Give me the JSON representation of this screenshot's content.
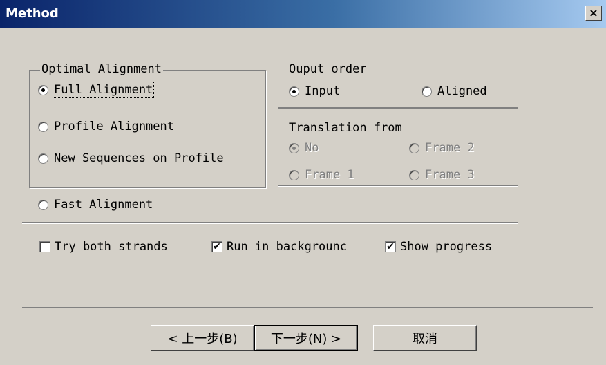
{
  "window": {
    "title": "Method",
    "close_glyph": "×"
  },
  "optimal_alignment": {
    "legend": "Optimal Alignment",
    "options": [
      {
        "label": "Full Alignment",
        "checked": true
      },
      {
        "label": "Profile Alignment",
        "checked": false
      },
      {
        "label": "New Sequences on Profile",
        "checked": false
      }
    ]
  },
  "fast_alignment": {
    "label": "Fast Alignment",
    "checked": false
  },
  "output_order": {
    "heading": "Ouput order",
    "options": [
      {
        "label": "Input",
        "checked": true
      },
      {
        "label": "Aligned",
        "checked": false
      }
    ]
  },
  "translation": {
    "heading": "Translation from",
    "options": [
      {
        "label": "No",
        "checked": true,
        "disabled": true
      },
      {
        "label": "Frame 2",
        "checked": false,
        "disabled": true
      },
      {
        "label": "Frame 1",
        "checked": false,
        "disabled": true
      },
      {
        "label": "Frame 3",
        "checked": false,
        "disabled": true
      }
    ]
  },
  "checkboxes": [
    {
      "label": "Try both strands",
      "checked": false
    },
    {
      "label": "Run in backgrounc",
      "checked": true
    },
    {
      "label": "Show progress",
      "checked": true
    }
  ],
  "buttons": {
    "back": "< 上一步(B)",
    "next": "下一步(N) >",
    "cancel": "取消"
  },
  "icons": {
    "checkmark": "✔",
    "check_box": "check-icon",
    "radio": "radio-icon"
  }
}
